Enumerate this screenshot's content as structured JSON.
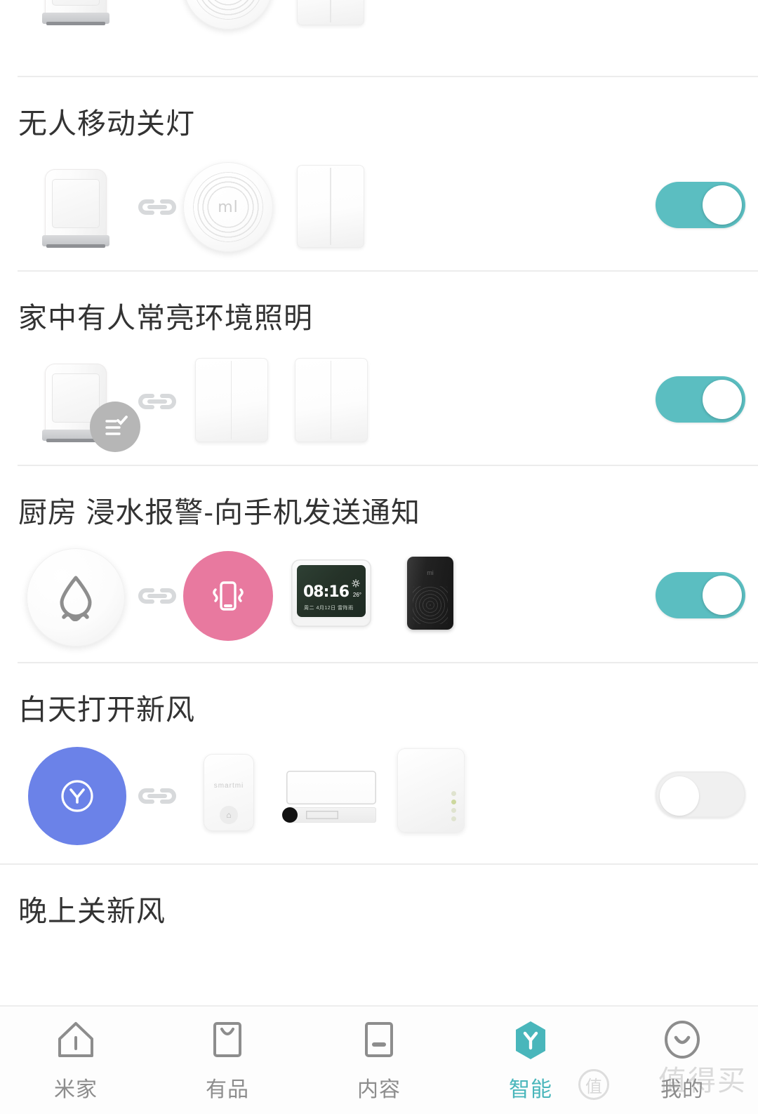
{
  "app": {
    "accent_on_color": "#5bbec1",
    "accent_off_color": "#f0f0f0",
    "active_tab_color": "#49b6bb"
  },
  "scenes": [
    {
      "title": "",
      "partial": true,
      "toggle_state": "on",
      "toggle_label": "开关"
    },
    {
      "title": "无人移动关灯",
      "toggle_state": "on",
      "toggle_label": "开关",
      "devices": [
        "motion-sensor",
        "gateway",
        "wall-switch"
      ]
    },
    {
      "title": "家中有人常亮环境照明",
      "toggle_state": "on",
      "toggle_label": "开关",
      "devices": [
        "motion-sensor-condition",
        "wall-switch",
        "wall-switch"
      ]
    },
    {
      "title": "厨房 浸水报警-向手机发送通知",
      "toggle_state": "on",
      "toggle_label": "开关",
      "devices": [
        "water-sensor",
        "phone-vibrate",
        "smart-clock",
        "smart-speaker"
      ],
      "clock": {
        "time": "08:16",
        "temp": "26°",
        "meta": "周二 4月12日 雷阵雨"
      }
    },
    {
      "title": "白天打开新风",
      "toggle_state": "off",
      "toggle_label": "开关",
      "devices": [
        "timer",
        "smartmi-sensor",
        "ac-unit",
        "fresh-air-box"
      ],
      "smartmi_brand": "smartmi"
    },
    {
      "title": "晚上关新风",
      "partial_bottom": true
    }
  ],
  "tabbar": {
    "items": [
      {
        "label": "米家",
        "icon": "home-icon",
        "active": false
      },
      {
        "label": "有品",
        "icon": "bag-icon",
        "active": false
      },
      {
        "label": "内容",
        "icon": "content-icon",
        "active": false
      },
      {
        "label": "智能",
        "icon": "automation-icon",
        "active": true
      },
      {
        "label": "我的",
        "icon": "profile-icon",
        "active": false
      }
    ]
  },
  "watermark": {
    "text": "值得买",
    "mark": "值"
  }
}
